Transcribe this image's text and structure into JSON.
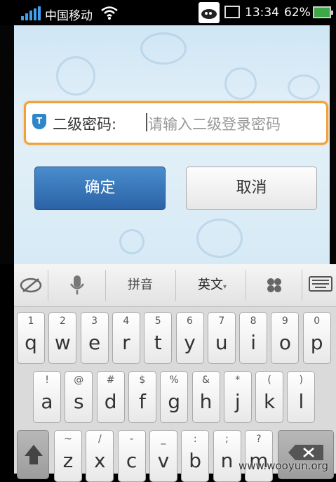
{
  "status_bar": {
    "carrier": "中国移动",
    "time": "13:34",
    "battery_percent": "62%"
  },
  "dialog": {
    "password_label": "二级密码:",
    "password_placeholder": "请输入二级登录密码",
    "confirm_button": "确定",
    "cancel_button": "取消"
  },
  "keyboard": {
    "toolbar": {
      "pinyin_label": "拼音",
      "english_label": "英文"
    },
    "row1": [
      {
        "num": "1",
        "letter": "q"
      },
      {
        "num": "2",
        "letter": "w"
      },
      {
        "num": "3",
        "letter": "e"
      },
      {
        "num": "4",
        "letter": "r"
      },
      {
        "num": "5",
        "letter": "t"
      },
      {
        "num": "6",
        "letter": "y"
      },
      {
        "num": "7",
        "letter": "u"
      },
      {
        "num": "8",
        "letter": "i"
      },
      {
        "num": "9",
        "letter": "o"
      },
      {
        "num": "0",
        "letter": "p"
      }
    ],
    "row2": [
      {
        "sym": "!",
        "letter": "a"
      },
      {
        "sym": "@",
        "letter": "s"
      },
      {
        "sym": "#",
        "letter": "d"
      },
      {
        "sym": "$",
        "letter": "f"
      },
      {
        "sym": "%",
        "letter": "g"
      },
      {
        "sym": "&",
        "letter": "h"
      },
      {
        "sym": "*",
        "letter": "j"
      },
      {
        "sym": "(",
        "letter": "k"
      },
      {
        "sym": ")",
        "letter": "l"
      }
    ],
    "row3": [
      {
        "sym": "~",
        "letter": "z"
      },
      {
        "sym": "/",
        "letter": "x"
      },
      {
        "sym": "-",
        "letter": "c"
      },
      {
        "sym": "_",
        "letter": "v"
      },
      {
        "sym": ":",
        "letter": "b"
      },
      {
        "sym": ";",
        "letter": "n"
      },
      {
        "sym": "?",
        "letter": "m"
      }
    ]
  },
  "watermark": "www.wooyun.org",
  "colors": {
    "accent_orange": "#f0a13a",
    "confirm_blue": "#2a63a6",
    "signal_blue": "#3ea0f0",
    "battery_green": "#3ea848"
  }
}
